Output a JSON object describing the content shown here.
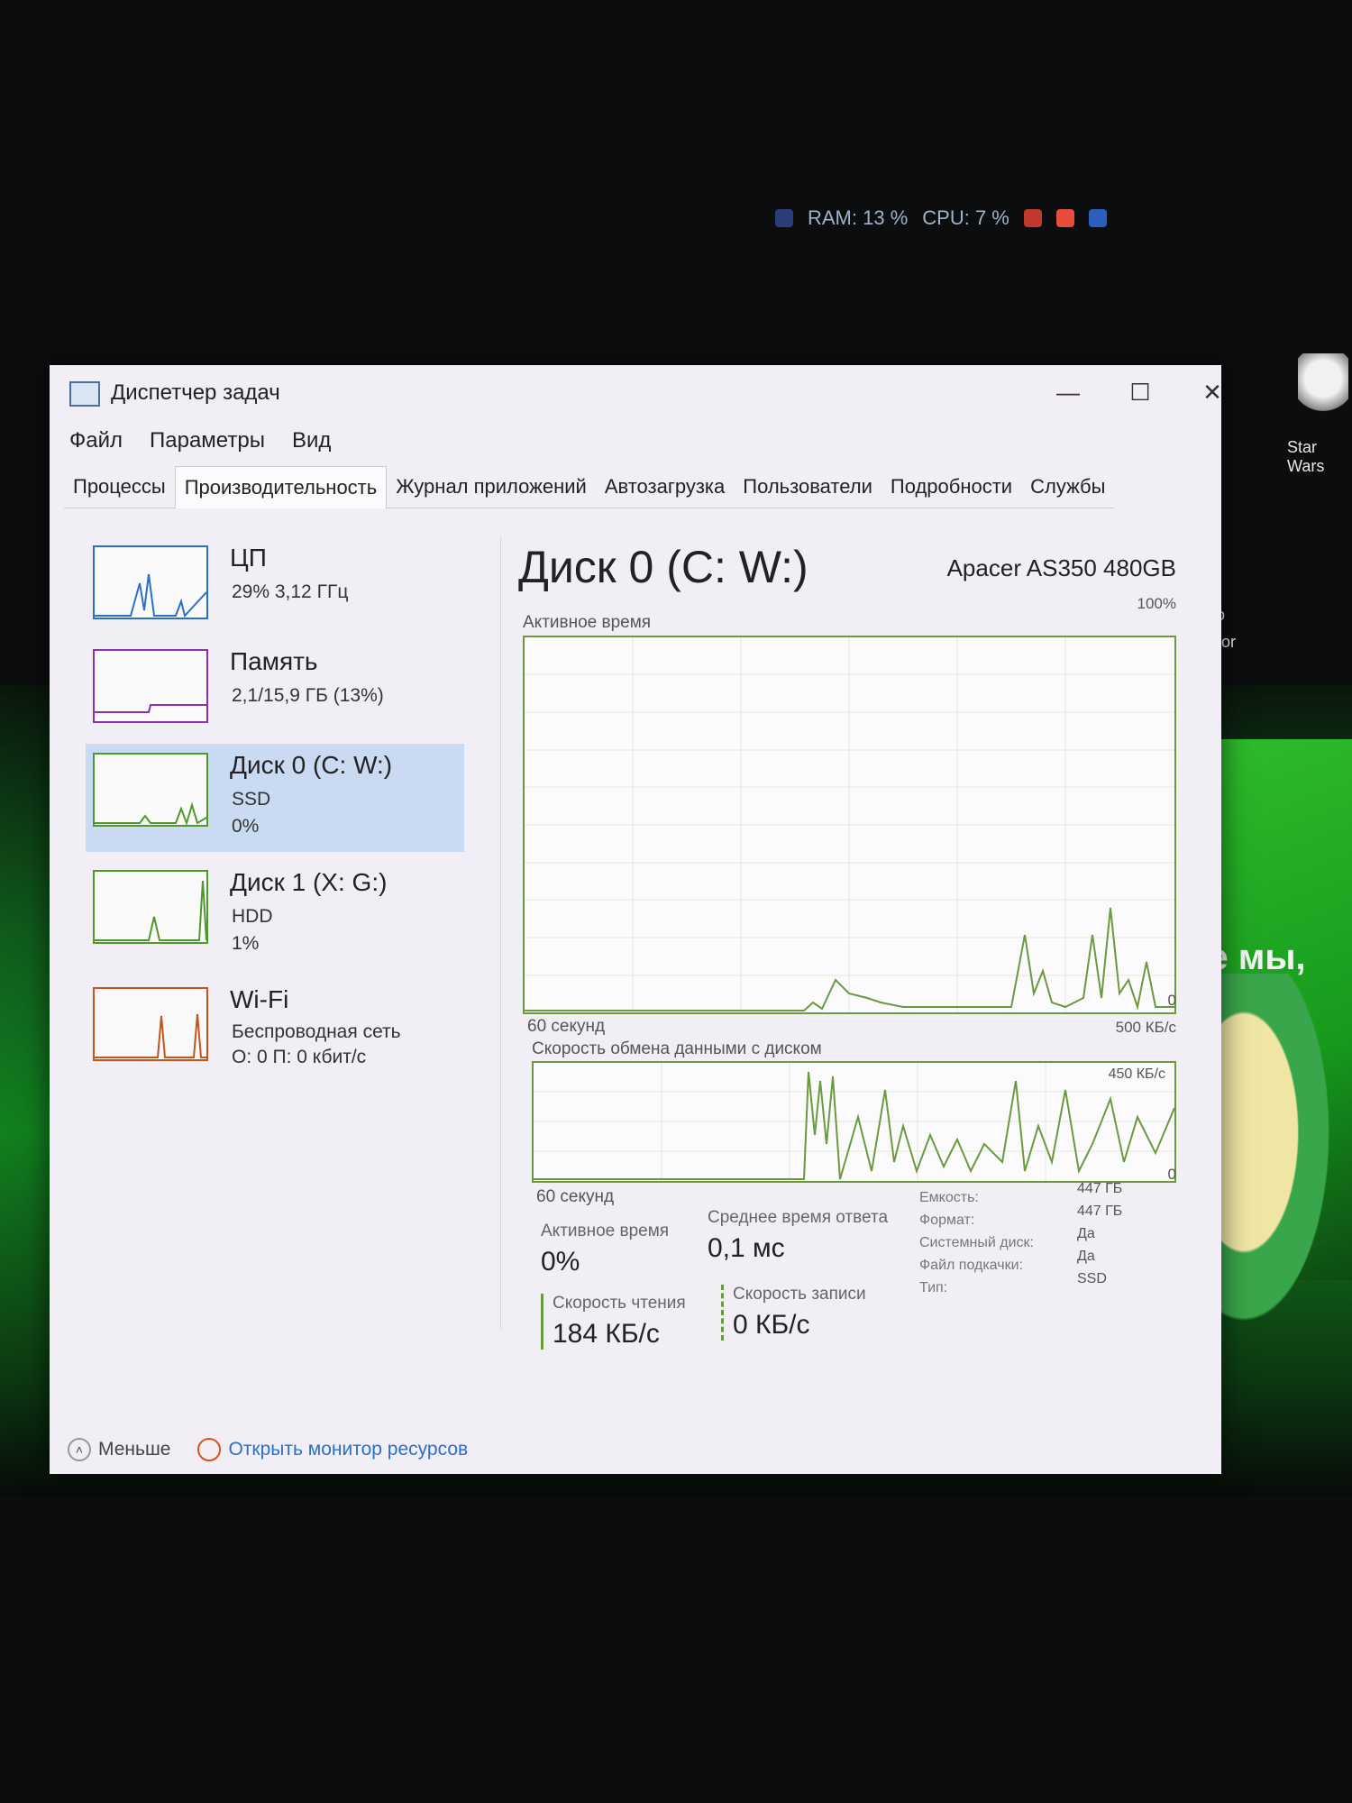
{
  "desktop": {
    "tray": {
      "ram": "RAM: 13 %",
      "cpu": "CPU: 7 %"
    },
    "icons": [
      {
        "label": "Star Wars"
      }
    ],
    "partial_texts": [
      "lo",
      "bor",
      "де мы,"
    ]
  },
  "window": {
    "title": "Диспетчер задач",
    "controls": {
      "minimize": "—",
      "maximize": "☐",
      "close": "✕"
    },
    "menu": [
      "Файл",
      "Параметры",
      "Вид"
    ],
    "tabs": [
      "Процессы",
      "Производительность",
      "Журнал приложений",
      "Автозагрузка",
      "Пользователи",
      "Подробности",
      "Службы"
    ],
    "active_tab": "Производительность"
  },
  "sidebar": {
    "items": [
      {
        "title": "ЦП",
        "lines": [
          "29% 3,12 ГГц"
        ],
        "color": "#2a6fc9"
      },
      {
        "title": "Память",
        "lines": [
          "2,1/15,9 ГБ (13%)"
        ],
        "color": "#8b2fb4"
      },
      {
        "title": "Диск 0 (C: W:)",
        "lines": [
          "SSD",
          "0%"
        ],
        "color": "#4d9a2a",
        "selected": true
      },
      {
        "title": "Диск 1 (X: G:)",
        "lines": [
          "HDD",
          "1%"
        ],
        "color": "#4d9a2a"
      },
      {
        "title": "Wi-Fi",
        "lines": [
          "Беспроводная сеть",
          "О: 0 П: 0 кбит/с"
        ],
        "color": "#c8531a"
      }
    ]
  },
  "main": {
    "title": "Диск 0 (C: W:)",
    "device": "Apacer AS350 480GB",
    "graph1": {
      "label": "Активное время",
      "max": "100%",
      "min": "0",
      "time": "60 секунд"
    },
    "graph2": {
      "label": "Скорость обмена данными с диском",
      "max": "500 КБ/с",
      "mid": "450 КБ/с",
      "min": "0",
      "time": "60 секунд"
    },
    "stats": {
      "active_time": {
        "label": "Активное время",
        "value": "0%"
      },
      "avg_response": {
        "label": "Среднее время ответа",
        "value": "0,1 мс"
      },
      "read_speed": {
        "label": "Скорость чтения",
        "value": "184 КБ/с"
      },
      "write_speed": {
        "label": "Скорость записи",
        "value": "0 КБ/с"
      }
    },
    "properties": [
      {
        "label": "Емкость:",
        "value": "447 ГБ"
      },
      {
        "label": "Формат:",
        "value": "447 ГБ"
      },
      {
        "label": "Системный диск:",
        "value": "Да"
      },
      {
        "label": "Файл подкачки:",
        "value": "Да"
      },
      {
        "label": "Тип:",
        "value": "SSD"
      }
    ]
  },
  "footer": {
    "less": "Меньше",
    "open_monitor": "Открыть монитор ресурсов"
  }
}
